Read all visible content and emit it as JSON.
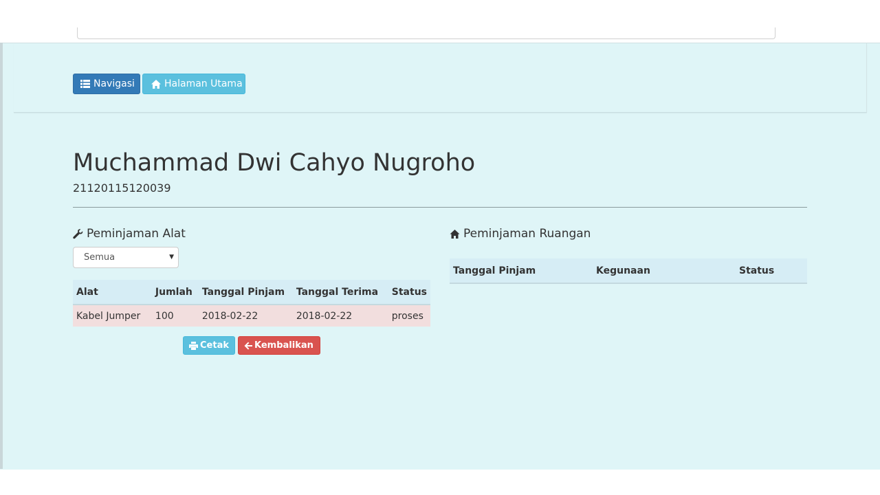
{
  "navbar": {
    "nav_button_label": "Navigasi",
    "home_button_label": "Halaman Utama"
  },
  "user": {
    "name": "Muchammad Dwi Cahyo Nugroho",
    "id_number": "21120115120039"
  },
  "equipment_loans": {
    "heading": "Peminjaman Alat",
    "filter_selected": "Semua",
    "columns": [
      "Alat",
      "Jumlah",
      "Tanggal Pinjam",
      "Tanggal Terima",
      "Status"
    ],
    "rows": [
      [
        "Kabel Jumper",
        "100",
        "2018-02-22",
        "2018-02-22",
        "proses"
      ]
    ],
    "print_button_label": "Cetak",
    "return_button_label": "Kembalikan"
  },
  "room_loans": {
    "heading": "Peminjaman Ruangan",
    "columns": [
      "Tanggal Pinjam",
      "Kegunaan",
      "Status"
    ],
    "rows": []
  },
  "colors": {
    "page_background": "#dff5f7",
    "primary": "#337ab7",
    "info": "#5bc0de",
    "danger": "#d9534f",
    "row_danger": "#f2dede"
  },
  "icons": {
    "nav": "list-icon",
    "home": "home-icon",
    "wrench": "wrench-icon",
    "print": "print-icon",
    "back": "arrow-left-icon"
  }
}
